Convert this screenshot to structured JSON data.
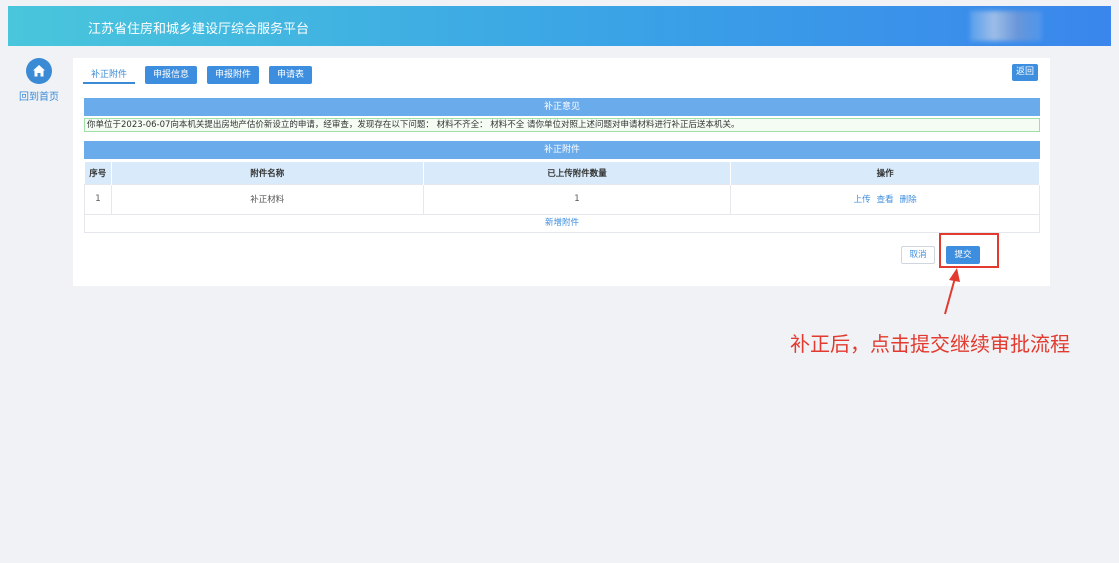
{
  "header": {
    "title": "江苏省住房和城乡建设厅综合服务平台"
  },
  "sidebar": {
    "home_label": "回到首页"
  },
  "tabs": [
    {
      "label": "补正附件"
    },
    {
      "label": "申报信息"
    },
    {
      "label": "申报附件"
    },
    {
      "label": "申请表"
    }
  ],
  "toolbar": {
    "back_label": "返回"
  },
  "opinion": {
    "header": "补正意见",
    "text": "你单位于2023-06-07向本机关提出房地产估价新设立的申请，经审查，发现存在以下问题：  材料不齐全：  材料不全 请你单位对照上述问题对申请材料进行补正后送本机关。"
  },
  "attachments": {
    "header": "补正附件",
    "columns": [
      "序号",
      "附件名称",
      "已上传附件数量",
      "操作"
    ],
    "rows": [
      {
        "index": "1",
        "name": "补正材料",
        "count": "1",
        "actions": [
          "上传",
          "查看",
          "删除"
        ]
      }
    ],
    "add_label": "新增附件"
  },
  "footer": {
    "cancel_label": "取消",
    "submit_label": "提交"
  },
  "annotation": {
    "text": "补正后，点击提交继续审批流程",
    "color": "#e23a2f"
  },
  "colors": {
    "primary": "#3d8ede",
    "header_gradient_start": "#49c6dc",
    "header_gradient_end": "#3a86ec"
  }
}
